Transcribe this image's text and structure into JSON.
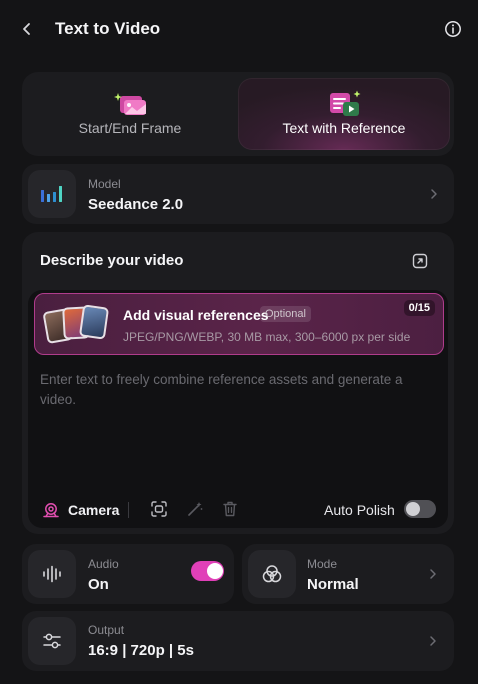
{
  "header": {
    "title": "Text to Video"
  },
  "mode_tabs": [
    {
      "label": "Start/End Frame",
      "selected": false
    },
    {
      "label": "Text with Reference",
      "selected": true
    }
  ],
  "model": {
    "label": "Model",
    "value": "Seedance 2.0"
  },
  "describe": {
    "title": "Describe your video",
    "references": {
      "title": "Add visual references",
      "badge": "Optional",
      "subtitle": "JPEG/PNG/WEBP, 30 MB max, 300–6000 px per side",
      "counter": "0/15"
    },
    "prompt": {
      "value": "",
      "placeholder": "Enter text to freely combine reference assets and generate a video."
    },
    "toolbar": {
      "camera_label": "Camera",
      "auto_polish_label": "Auto Polish",
      "auto_polish_on": false
    }
  },
  "audio": {
    "label": "Audio",
    "value": "On",
    "enabled": true
  },
  "mode": {
    "label": "Mode",
    "value": "Normal"
  },
  "output": {
    "label": "Output",
    "value": "16:9 | 720p | 5s"
  },
  "colors": {
    "accent": "#e040b8",
    "background": "#141416",
    "card": "#1c1c1f"
  }
}
